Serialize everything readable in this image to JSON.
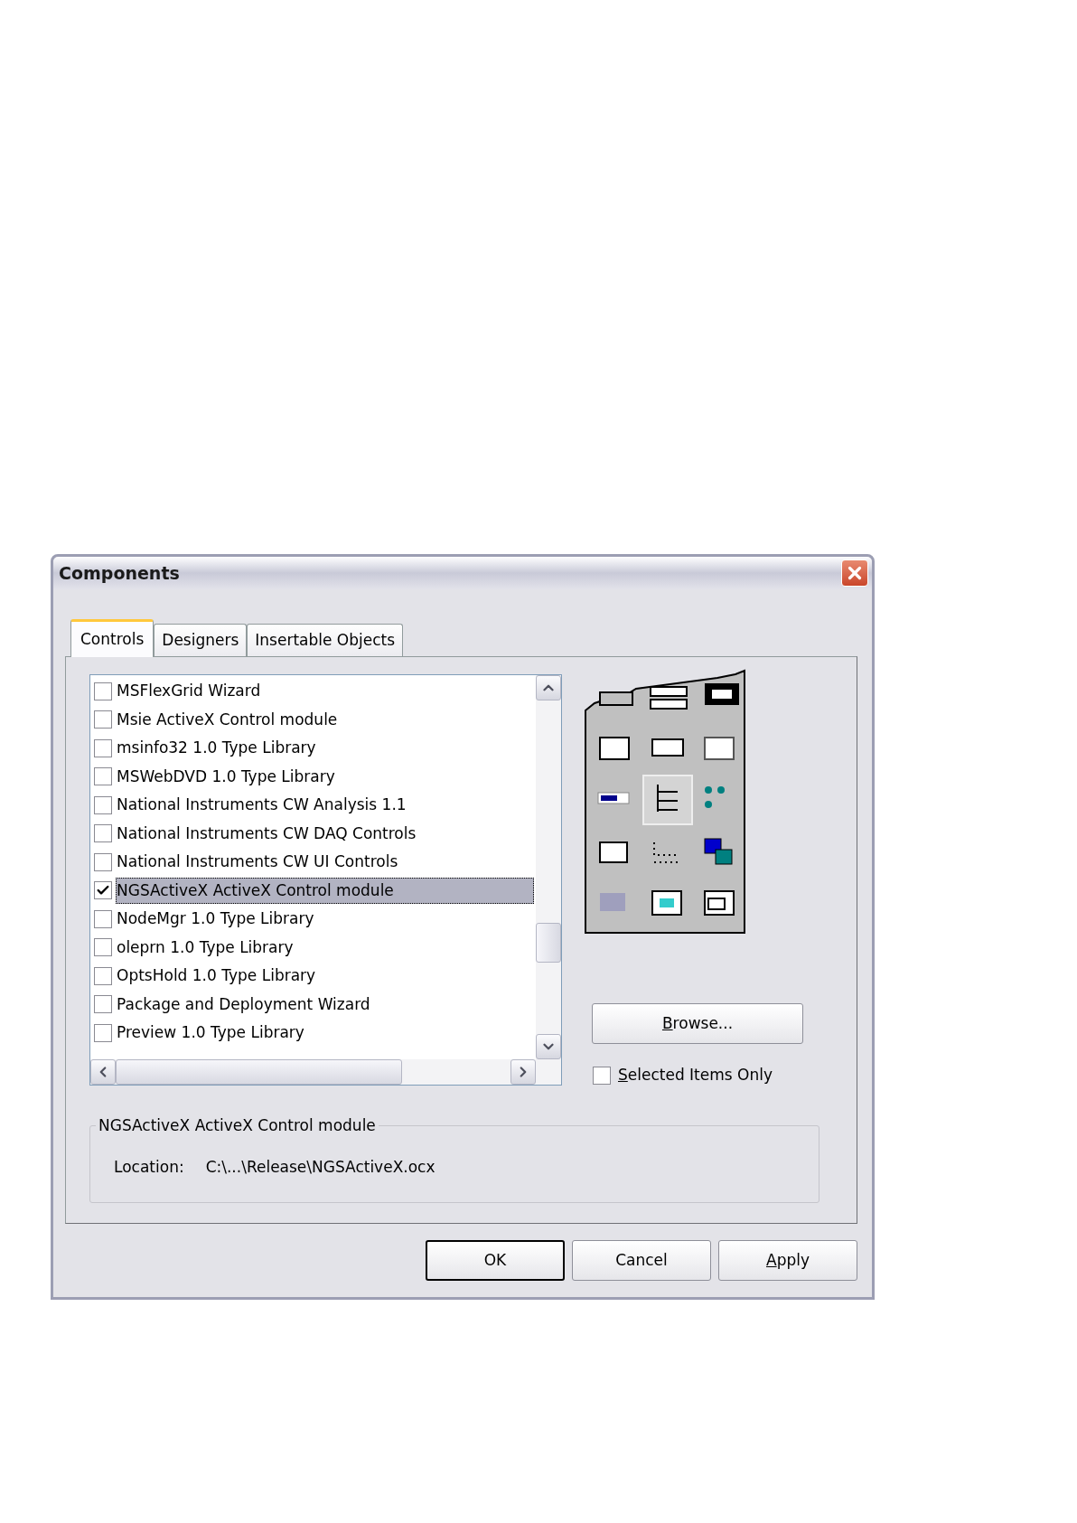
{
  "window": {
    "title": "Components"
  },
  "tabs": [
    {
      "label": "Controls",
      "selected": true
    },
    {
      "label": "Designers",
      "selected": false
    },
    {
      "label": "Insertable Objects",
      "selected": false
    }
  ],
  "components_list": {
    "items": [
      {
        "label": "MSFlexGrid Wizard",
        "checked": false,
        "selected": false
      },
      {
        "label": "Msie ActiveX Control module",
        "checked": false,
        "selected": false
      },
      {
        "label": "msinfo32 1.0 Type Library",
        "checked": false,
        "selected": false
      },
      {
        "label": "MSWebDVD 1.0 Type Library",
        "checked": false,
        "selected": false
      },
      {
        "label": "National Instruments CW Analysis 1.1",
        "checked": false,
        "selected": false
      },
      {
        "label": "National Instruments CW DAQ Controls",
        "checked": false,
        "selected": false
      },
      {
        "label": "National Instruments CW UI Controls",
        "checked": false,
        "selected": false
      },
      {
        "label": "NGSActiveX ActiveX Control module",
        "checked": true,
        "selected": true
      },
      {
        "label": "NodeMgr 1.0 Type Library",
        "checked": false,
        "selected": false
      },
      {
        "label": "oleprn 1.0 Type Library",
        "checked": false,
        "selected": false
      },
      {
        "label": "OptsHold 1.0 Type Library",
        "checked": false,
        "selected": false
      },
      {
        "label": "Package and Deployment Wizard",
        "checked": false,
        "selected": false
      },
      {
        "label": "Preview 1.0 Type Library",
        "checked": false,
        "selected": false
      }
    ]
  },
  "browse_button": {
    "key": "B",
    "rest": "rowse..."
  },
  "selected_items_only": {
    "key": "S",
    "rest": "elected Items Only",
    "checked": false
  },
  "details": {
    "title": "NGSActiveX ActiveX Control module",
    "location_label": "Location:",
    "location": "C:\\...\\Release\\NGSActiveX.ocx"
  },
  "buttons": [
    {
      "label": "OK",
      "default": true
    },
    {
      "label": "Cancel",
      "default": false
    },
    {
      "key": "A",
      "rest": "pply",
      "default": false
    }
  ]
}
